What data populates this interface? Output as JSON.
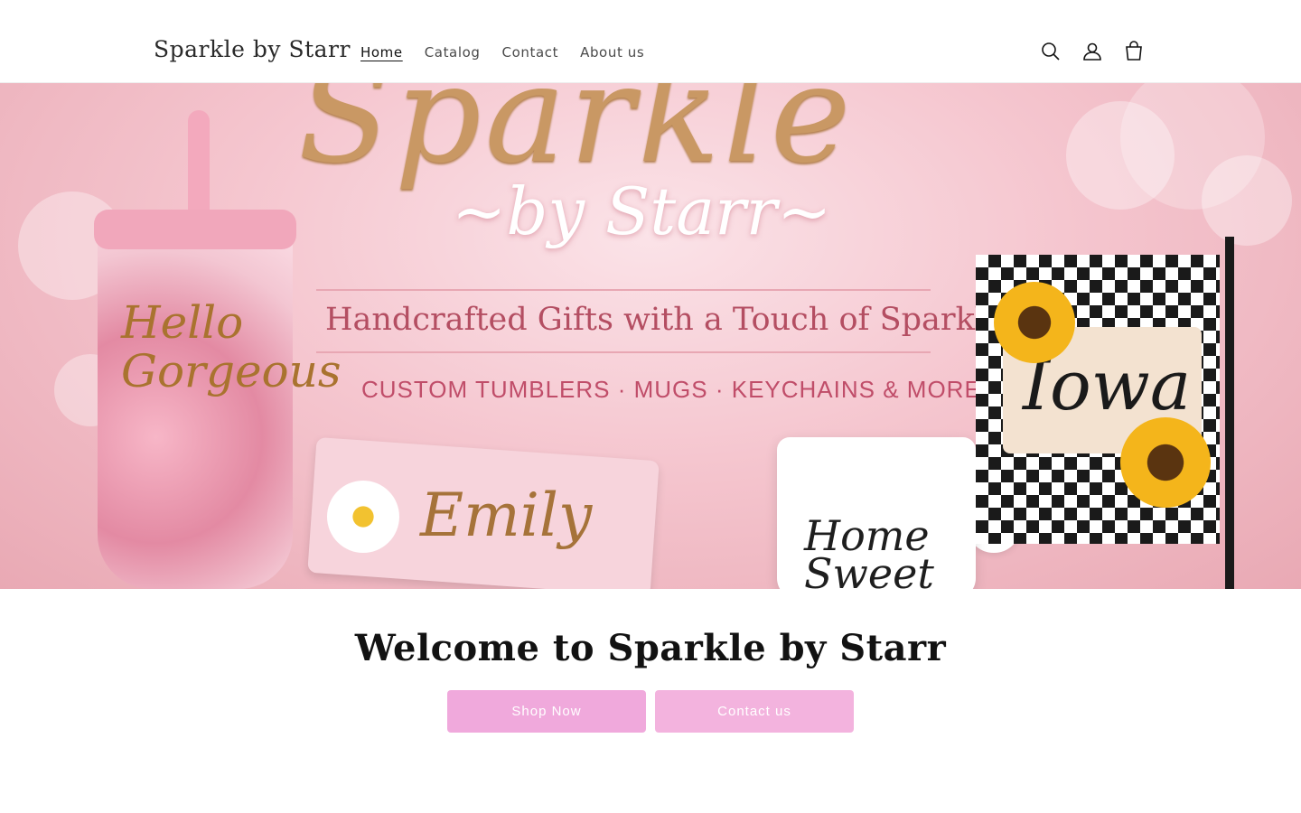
{
  "header": {
    "logo": "Sparkle by Starr",
    "nav": [
      {
        "label": "Home",
        "active": true
      },
      {
        "label": "Catalog",
        "active": false
      },
      {
        "label": "Contact",
        "active": false
      },
      {
        "label": "About us",
        "active": false
      }
    ],
    "icons": [
      "search-icon",
      "account-icon",
      "cart-icon"
    ]
  },
  "hero": {
    "title": "Sparkle",
    "subtitle": "~by Starr~",
    "tagline": "Handcrafted Gifts with a Touch of Sparkle",
    "products": "CUSTOM TUMBLERS · MUGS · KEYCHAINS & MORE",
    "tumbler_text": "Hello\nGorgeous",
    "keychain_text": "Emily",
    "mug_text": "Home\nSweet",
    "flag_text": "Iowa"
  },
  "main": {
    "welcome": "Welcome to Sparkle by Starr",
    "buttons": {
      "shop": "Shop Now",
      "contact": "Contact us"
    }
  },
  "colors": {
    "button": "#f0a9dc",
    "hero_gold": "#c99864",
    "hero_rose": "#b44e62"
  }
}
